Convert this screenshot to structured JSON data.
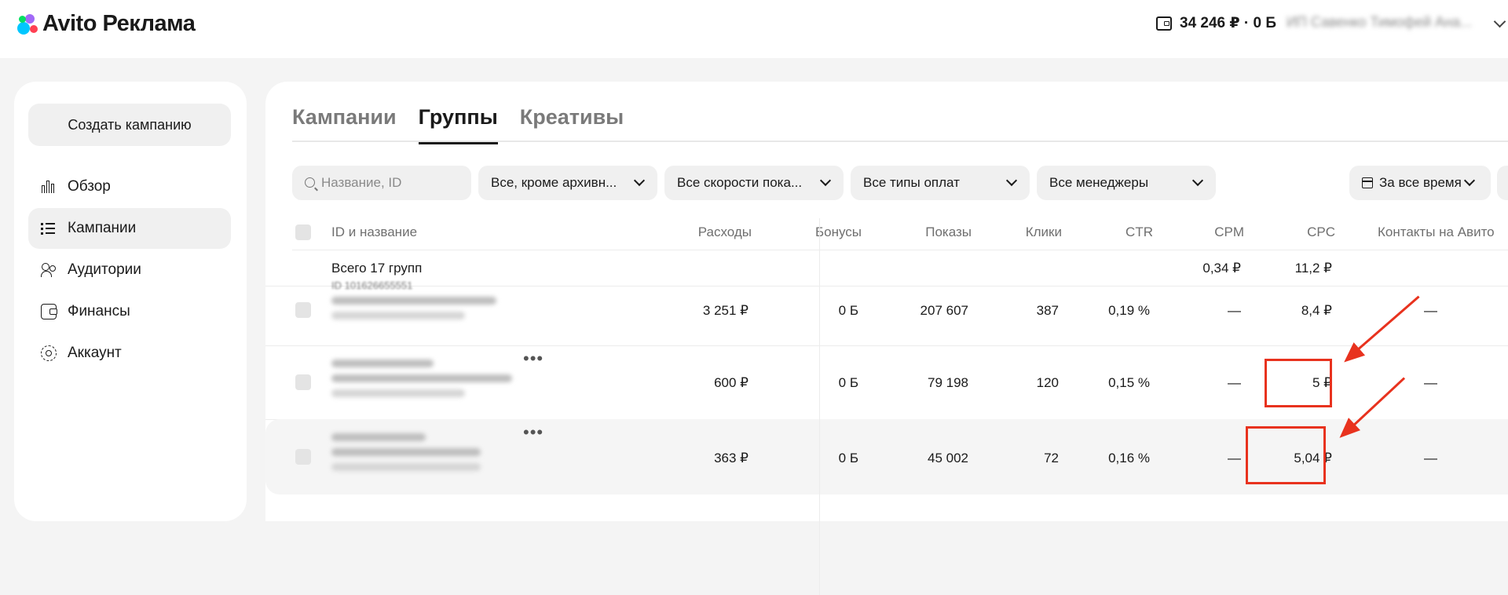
{
  "header": {
    "logo_text": "Avito Реклама",
    "balance": "34 246 ₽ · 0 Б",
    "user_name": "ИП Савенко Тимофей Ана..."
  },
  "sidebar": {
    "create_button": "Создать кампанию",
    "items": [
      {
        "label": "Обзор",
        "icon": "chart-bars-icon",
        "active": false
      },
      {
        "label": "Кампании",
        "icon": "list-icon",
        "active": true
      },
      {
        "label": "Аудитории",
        "icon": "users-icon",
        "active": false
      },
      {
        "label": "Финансы",
        "icon": "wallet-icon",
        "active": false
      },
      {
        "label": "Аккаунт",
        "icon": "gear-icon",
        "active": false
      }
    ]
  },
  "tabs": [
    {
      "label": "Кампании",
      "active": false
    },
    {
      "label": "Группы",
      "active": true
    },
    {
      "label": "Креативы",
      "active": false
    }
  ],
  "filters": {
    "search_placeholder": "Название, ID",
    "status": "Все, кроме архивн...",
    "speed": "Все скорости пока...",
    "payment": "Все типы оплат",
    "managers": "Все менеджеры",
    "period": "За все время"
  },
  "table": {
    "columns": [
      "ID и название",
      "Расходы",
      "Бонусы",
      "Показы",
      "Клики",
      "CTR",
      "CPM",
      "CPC",
      "Контакты на Авито"
    ],
    "total": {
      "label": "Всего 17 групп",
      "cpm": "0,34 ₽",
      "cpc": "11,2 ₽"
    },
    "rows": [
      {
        "id": "ID 101626655551",
        "spend": "3 251 ₽",
        "bonus": "0 Б",
        "views": "207 607",
        "clicks": "387",
        "ctr": "0,19 %",
        "cpm": "—",
        "cpc": "8,4 ₽",
        "contacts": "—"
      },
      {
        "spend": "600 ₽",
        "bonus": "0 Б",
        "views": "79 198",
        "clicks": "120",
        "ctr": "0,15 %",
        "cpm": "—",
        "cpc": "5 ₽",
        "contacts": "—"
      },
      {
        "spend": "363 ₽",
        "bonus": "0 Б",
        "views": "45 002",
        "clicks": "72",
        "ctr": "0,16 %",
        "cpm": "—",
        "cpc": "5,04 ₽",
        "contacts": "—"
      }
    ]
  },
  "colors": {
    "annotation": "#e8321e",
    "panel": "#ffffff",
    "background": "#f4f4f4"
  }
}
